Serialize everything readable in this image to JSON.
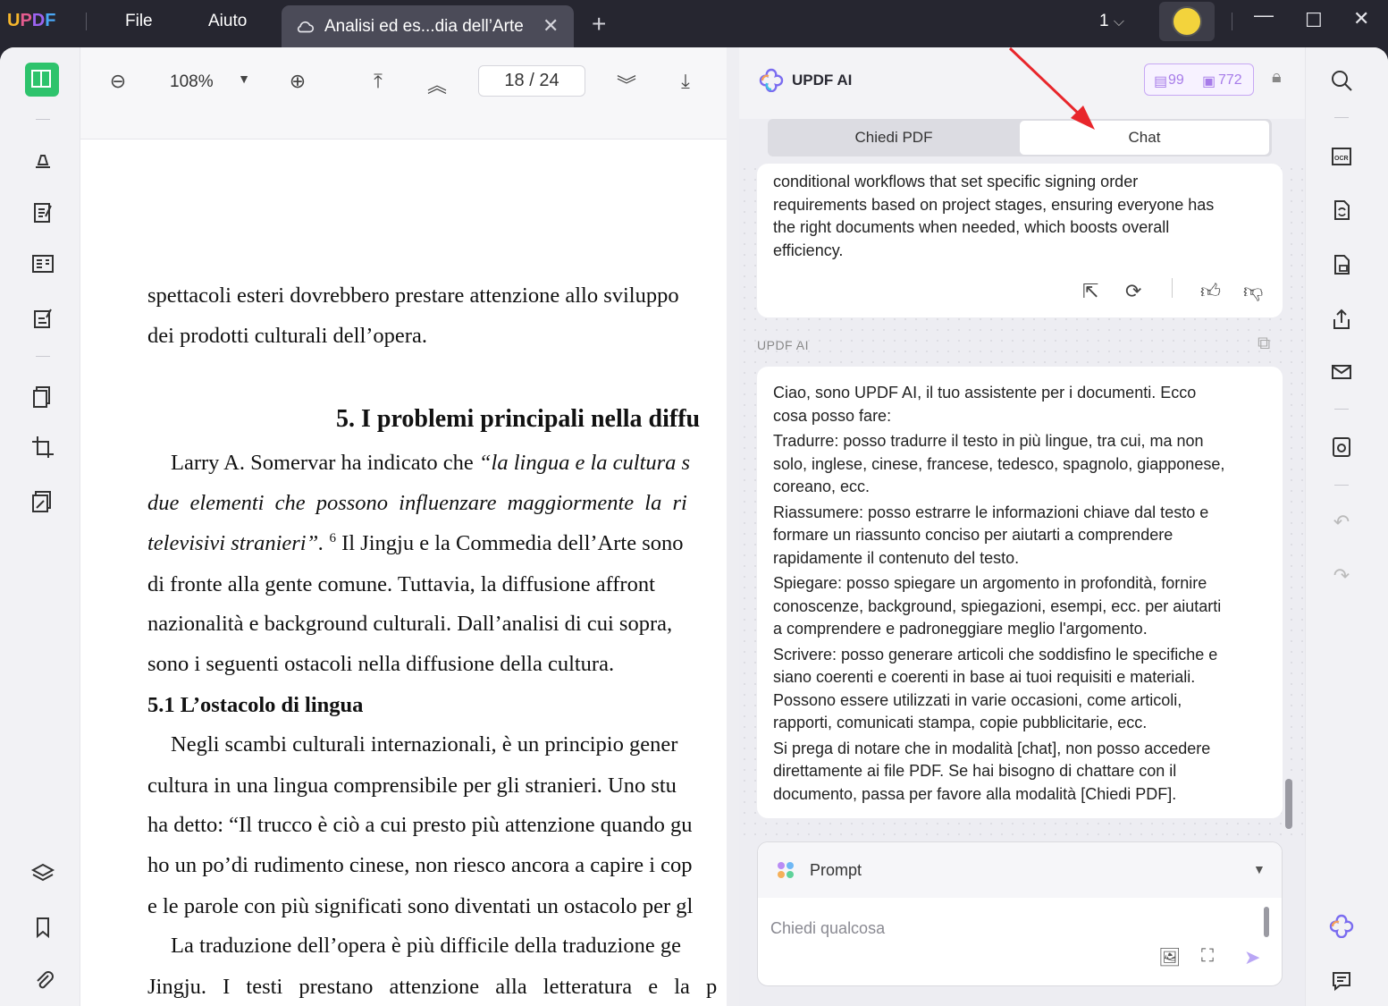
{
  "app": {
    "logo": "UPDF",
    "menu": [
      "File",
      "Aiuto"
    ],
    "tab_title": "Analisi ed es...dia dell’Arte",
    "page_indicator": "1",
    "window_controls": [
      "minimize-icon",
      "maximize-icon",
      "close-icon"
    ]
  },
  "toolbar": {
    "zoom": "108%",
    "page_current": "18",
    "page_sep": "/",
    "page_total": "24"
  },
  "document": {
    "lines": [
      "spettacoli esteri dovrebbero prestare attenzione allo sviluppo",
      "dei prodotti culturali dell’opera.",
      "5. I problemi principali nella diffu",
      "Larry A. Somervar ha indicato che ",
      "“la lingua e la cultura s",
      "due elementi che possono influenzare maggiormente la ri",
      "televisivi stranieri”.",
      "6",
      " Il Jingju e la Commedia dell’Arte sono",
      "di fronte alla gente comune. Tuttavia, la diffusione affront",
      "nazionalità e background culturali. Dall’analisi di cui sopra,",
      "sono i seguenti ostacoli nella diffusione della cultura.",
      "5.1 L’ostacolo di lingua",
      "Negli scambi culturali internazionali, è un principio gener",
      "cultura in una lingua comprensibile per gli stranieri. Uno stu",
      "ha detto: “Il trucco è ciò a cui presto più attenzione quando gu",
      "ho un po’di rudimento cinese, non riesco ancora a capire i cop",
      "e le parole con più significati sono diventati un ostacolo per gl",
      "La traduzione dell’opera è più difficile della traduzione ge",
      "Jingju. I testi prestano attenzione alla letteratura e la p"
    ]
  },
  "ai": {
    "title": "UPDF AI",
    "credits_pdf": "99",
    "credits_chat": "772",
    "tab_pdf": "Chiedi PDF",
    "tab_chat": "Chat",
    "prev_message": [
      "conditional workflows that set specific signing order",
      "requirements based on project stages, ensuring everyone has",
      "the right documents when needed, which boosts overall",
      "efficiency."
    ],
    "sender_label": "UPDF AI",
    "message": [
      "Ciao, sono UPDF AI, il tuo assistente per i documenti. Ecco",
      "cosa posso fare:",
      "Tradurre: posso tradurre il testo in più lingue, tra cui, ma non",
      "solo, inglese, cinese, francese, tedesco, spagnolo, giapponese,",
      "coreano, ecc.",
      "Riassumere: posso estrarre le informazioni chiave dal testo e",
      "formare un riassunto conciso per aiutarti a comprendere",
      "rapidamente il contenuto del testo.",
      "Spiegare: posso spiegare un argomento in profondità, fornire",
      "conoscenze, background, spiegazioni, esempi, ecc. per aiutarti",
      "a comprendere e padroneggiare meglio l'argomento.",
      "Scrivere: posso generare articoli che soddisfino le specifiche e",
      "siano coerenti e coerenti in base ai tuoi requisiti e materiali.",
      "Possono essere utilizzati in varie occasioni, come articoli,",
      "rapporti, comunicati stampa, copie pubblicitarie, ecc.",
      "Si prega di notare che in modalità [chat], non posso accedere",
      "direttamente ai file PDF. Se hai bisogno di chattare con il",
      "documento, passa per favore alla modalità [Chiedi PDF]."
    ],
    "prompt_label": "Prompt",
    "input_placeholder": "Chiedi qualcosa"
  },
  "colors": {
    "accent": "#a77ce9",
    "annotation_arrow": "#e8262b",
    "titlebar": "#262630"
  }
}
